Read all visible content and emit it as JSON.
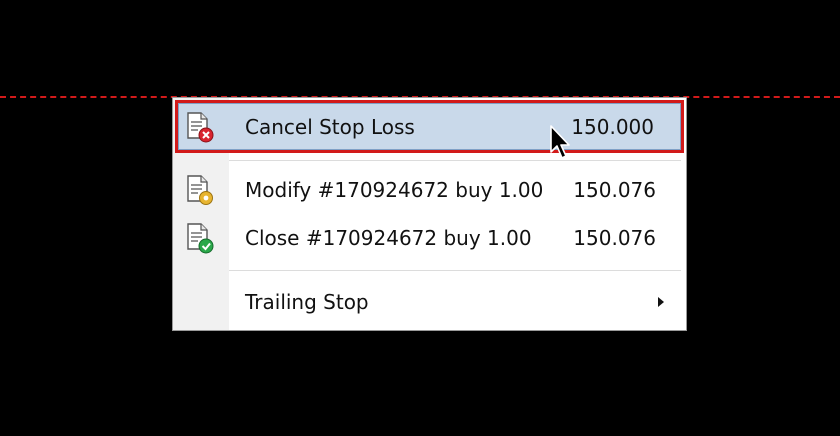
{
  "menu": {
    "items": [
      {
        "label": "Cancel Stop Loss",
        "value": "150.000",
        "icon": "cancel-order-icon",
        "highlighted": true
      },
      {
        "label": "Modify #170924672 buy 1.00",
        "value": "150.076",
        "icon": "modify-order-icon"
      },
      {
        "label": "Close #170924672 buy 1.00",
        "value": "150.076",
        "icon": "close-order-icon"
      },
      {
        "label": "Trailing Stop",
        "value": "",
        "icon": "",
        "submenu": true
      }
    ]
  },
  "colors": {
    "highlight_bg": "#c9d9ea",
    "annotation_red": "#d21a1a",
    "menu_bg": "#ffffff",
    "screen_bg": "#000000"
  }
}
